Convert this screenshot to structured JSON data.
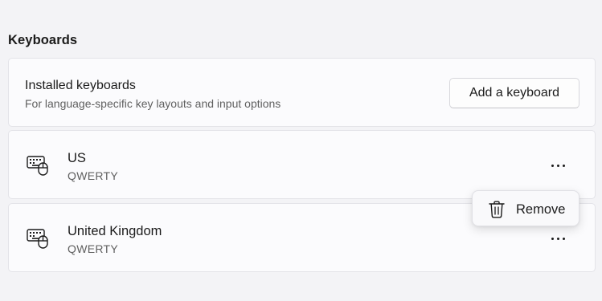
{
  "section": {
    "title": "Keyboards"
  },
  "installed": {
    "title": "Installed keyboards",
    "subtitle": "For language-specific key layouts and input options",
    "add_button_label": "Add a keyboard"
  },
  "keyboards": [
    {
      "name": "US",
      "layout": "QWERTY",
      "icon": "keyboard-icon",
      "more_icon": "more-options-icon"
    },
    {
      "name": "United Kingdom",
      "layout": "QWERTY",
      "icon": "keyboard-icon",
      "more_icon": "more-options-icon"
    }
  ],
  "context_menu": {
    "items": [
      {
        "label": "Remove",
        "icon": "trash-icon"
      }
    ]
  },
  "colors": {
    "background": "#f3f3f6",
    "card": "#fbfbfd",
    "text_primary": "#1b1b1b",
    "text_secondary": "#5f5f5f"
  }
}
